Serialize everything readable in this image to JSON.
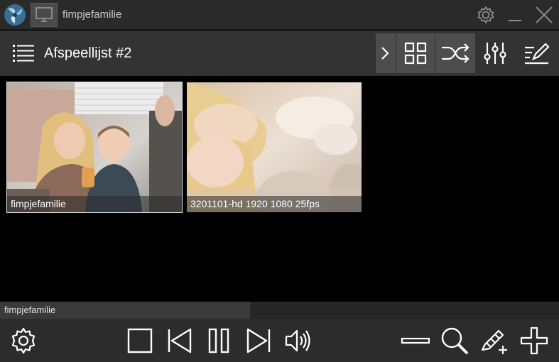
{
  "window": {
    "title": "fimpjefamilie",
    "icons": [
      "app-logo-icon",
      "monitor-icon",
      "gear-icon",
      "minimize-icon",
      "close-icon"
    ]
  },
  "toolbar": {
    "playlist_title": "Afspeellijst #2",
    "icons": [
      "menu-icon",
      "chevron-right-icon",
      "grid-icon",
      "shuffle-icon",
      "equalizer-icon",
      "edit-icon"
    ]
  },
  "thumbnails": [
    {
      "caption": "fimpjefamilie",
      "selected": true
    },
    {
      "caption": "3201101-hd 1920 1080 25fps",
      "selected": false
    }
  ],
  "status": {
    "text": "fimpjefamilie"
  },
  "bottombar": {
    "icons": [
      "gear-icon",
      "stop-icon",
      "previous-icon",
      "pause-icon",
      "next-icon",
      "volume-icon",
      "minus-icon",
      "search-icon",
      "add-tag-icon",
      "plus-icon"
    ]
  },
  "colors": {
    "titlebar_bg": "#2a2a2a",
    "toolbar_bg": "#333333",
    "content_bg": "#000000",
    "bottombar_bg": "#2c2c2c",
    "accent_logo": "#5aa8d8"
  }
}
